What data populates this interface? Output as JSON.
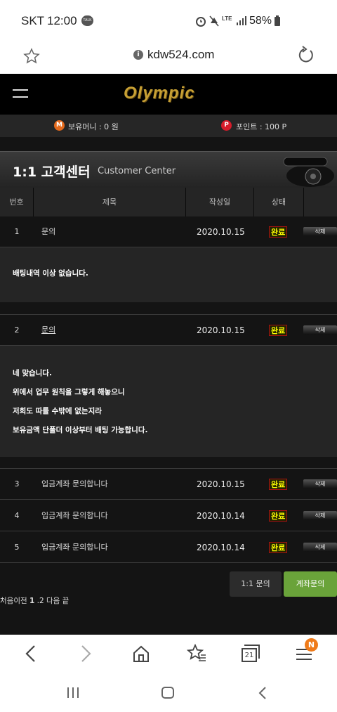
{
  "status": {
    "carrier": "SKT",
    "time": "12:00",
    "talk_icon": "TALK",
    "network": "LTE",
    "battery": "58%"
  },
  "browser": {
    "url": "kdw524.com",
    "tab_count": "21",
    "badge": "N"
  },
  "site": {
    "logo": "Olympic",
    "money_label": "보유머니 : 0 원",
    "point_label": "포인트 : 100 P",
    "money_icon": "M",
    "point_icon": "P"
  },
  "banner": {
    "title": "1:1 고객센터",
    "subtitle": "Customer Center"
  },
  "table": {
    "headers": [
      "번호",
      "제목",
      "작성일",
      "상태"
    ],
    "rows": [
      {
        "no": "1",
        "subject": "문의",
        "date": "2020.10.15",
        "status": "완료",
        "del": "삭제",
        "answer": [
          "배팅내역 이상 없습니다."
        ]
      },
      {
        "no": "2",
        "subject": "문의",
        "date": "2020.10.15",
        "status": "완료",
        "del": "삭제",
        "answer": [
          "네 맞습니다.",
          "위에서 업무 원칙을 그렇게 해놓으니",
          "저희도 따를 수밖에 없는지라",
          "보유금액 단폴더 이상부터 배팅 가능합니다."
        ]
      },
      {
        "no": "3",
        "subject": "입금계좌 문의합니다",
        "date": "2020.10.15",
        "status": "완료",
        "del": "삭제"
      },
      {
        "no": "4",
        "subject": "입금계좌 문의합니다",
        "date": "2020.10.14",
        "status": "완료",
        "del": "삭제"
      },
      {
        "no": "5",
        "subject": "입금계좌 문의합니다",
        "date": "2020.10.14",
        "status": "완료",
        "del": "삭제"
      }
    ]
  },
  "buttons": {
    "inquiry": "1:1 문의",
    "account": "계좌문의"
  },
  "pager": {
    "first_prev": "처음이전",
    "p1": "1",
    "sep": ".",
    "p2": "2",
    "next_last": "다음 끝"
  }
}
